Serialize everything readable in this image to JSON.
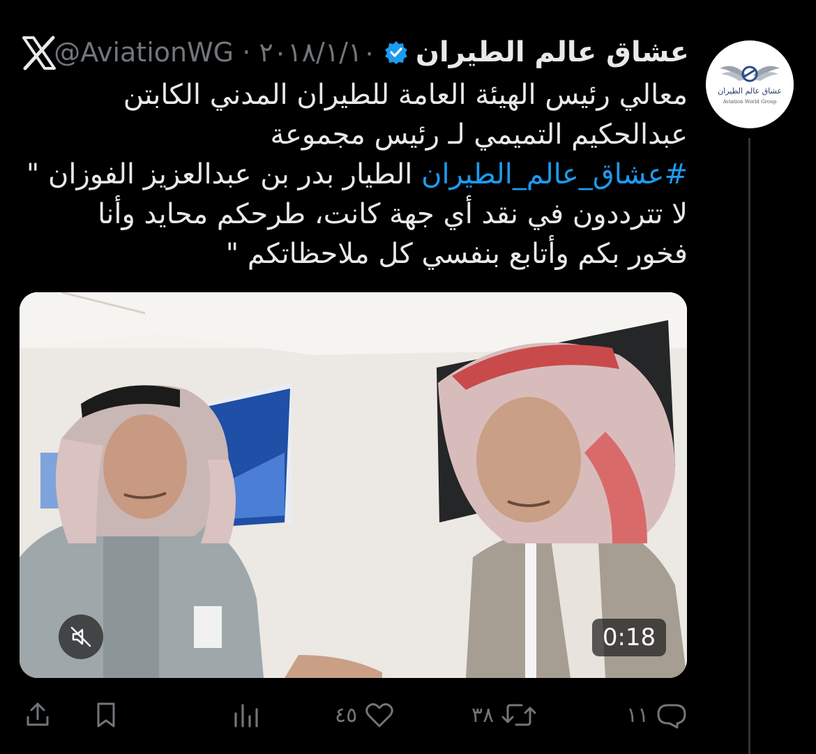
{
  "tweet": {
    "author_name": "عشاق عالم الطيران",
    "handle_date": "@AviationWG · ٢٠١٨/١/١٠",
    "lines": [
      "معالي رئيس الهيئة العامة للطيران المدني الكابتن",
      "عبدالحكيم التميمي لـ رئيس مجموعة",
      {
        "hashtag": "#عشاق_عالم_الطيران",
        "rest": " الطيار بدر بن عبدالعزيز الفوزان \""
      },
      "لا تترددون في نقد أي جهة كانت، طرحكم محايد وأنا",
      "فخور بكم وأتابع بنفسي كل ملاحظاتكم \""
    ],
    "avatar_logo_text": "عشاق عالم الطيران",
    "avatar_sub_text": "Aviation World Group"
  },
  "video": {
    "timer": "0:18"
  },
  "actions": {
    "replies": "١١",
    "retweets": "٣٨",
    "likes": "٤٥"
  },
  "icons": [
    "x-logo-icon",
    "verified-badge-icon",
    "mute-icon",
    "reply-icon",
    "retweet-icon",
    "like-icon",
    "analytics-icon",
    "bookmark-icon",
    "share-icon"
  ],
  "colors": {
    "background": "#000000",
    "text": "#e7e9ea",
    "secondary": "#71767b",
    "hashtag": "#1d9bf0",
    "verified": "#1d9bf0"
  }
}
